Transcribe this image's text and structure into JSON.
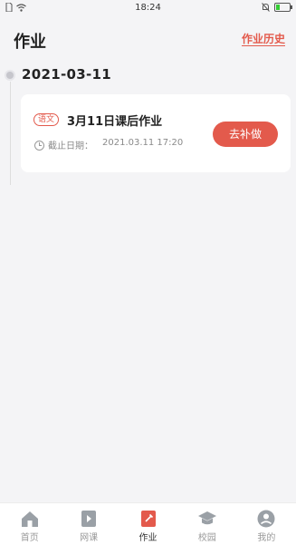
{
  "status_bar": {
    "time": "18:24"
  },
  "header": {
    "title": "作业",
    "history_link": "作业历史"
  },
  "timeline": {
    "date": "2021-03-11",
    "cards": [
      {
        "subject": "语文",
        "title": "3月11日课后作业",
        "deadline_label": "截止日期：",
        "deadline_value": "2021.03.11 17:20",
        "action": "去补做"
      }
    ]
  },
  "bottom_nav": {
    "items": [
      {
        "label": "首页",
        "icon": "home-icon"
      },
      {
        "label": "网课",
        "icon": "video-lesson-icon"
      },
      {
        "label": "作业",
        "icon": "homework-icon",
        "active": true
      },
      {
        "label": "校园",
        "icon": "graduation-cap-icon"
      },
      {
        "label": "我的",
        "icon": "profile-icon"
      }
    ],
    "active_color": "#e35a4c",
    "inactive_color": "#9a9a9a"
  },
  "colors": {
    "accent": "#e35a4c",
    "background": "#f4f4f6"
  }
}
